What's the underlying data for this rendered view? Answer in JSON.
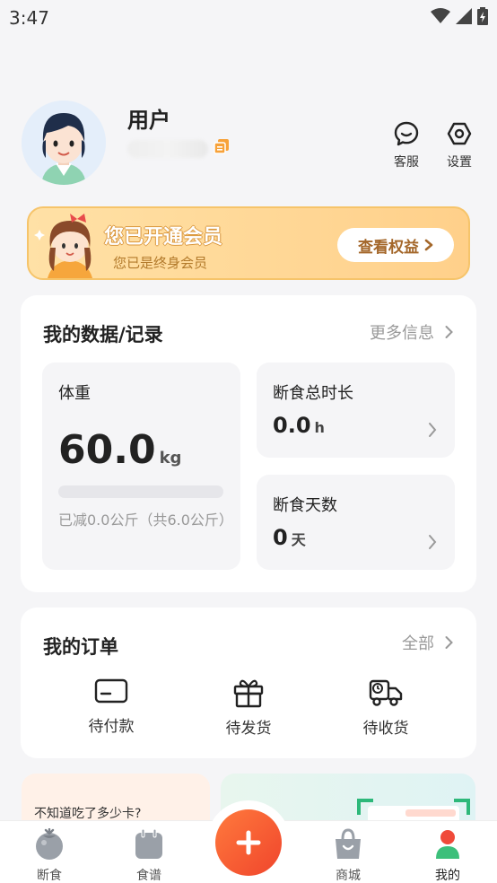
{
  "status_bar": {
    "time": "3:47"
  },
  "profile": {
    "name": "用户",
    "customer_service_label": "客服",
    "settings_label": "设置"
  },
  "vip": {
    "title": "您已开通会员",
    "subtitle": "您已是终身会员",
    "button_label": "查看权益"
  },
  "data_card": {
    "title": "我的数据/记录",
    "more_label": "更多信息",
    "weight": {
      "label": "体重",
      "value": "60.0",
      "unit": "kg",
      "progress_fraction": 0,
      "note": "已减0.0公斤（共6.0公斤）"
    },
    "fasting_total": {
      "label": "断食总时长",
      "value": "0.0",
      "unit": "h"
    },
    "fasting_days": {
      "label": "断食天数",
      "value": "0",
      "unit": "天"
    }
  },
  "orders": {
    "title": "我的订单",
    "all_label": "全部",
    "items": [
      {
        "label": "待付款",
        "icon": "card-icon"
      },
      {
        "label": "待发货",
        "icon": "gift-icon"
      },
      {
        "label": "待收货",
        "icon": "delivery-truck-icon"
      }
    ]
  },
  "promo": {
    "calorie_question": "不知道吃了多少卡?"
  },
  "tabbar": {
    "items": [
      {
        "label": "断食",
        "icon": "tomato-icon"
      },
      {
        "label": "食谱",
        "icon": "recipe-icon"
      },
      {
        "label": "商城",
        "icon": "shopping-bag-icon"
      },
      {
        "label": "我的",
        "icon": "person-icon"
      }
    ],
    "active": "我的"
  },
  "colors": {
    "accent": "#f0452c",
    "vip_gold": "#ffd08a",
    "progress": "#39c08c",
    "active_tab": "#f04a3a"
  }
}
